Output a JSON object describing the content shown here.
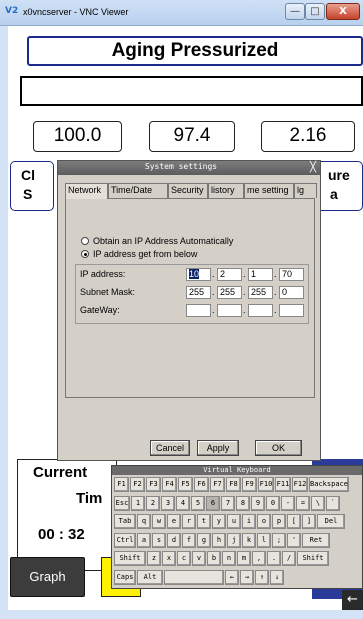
{
  "window": {
    "app_icon": "V2",
    "title": "x0vncserver - VNC Viewer",
    "min_glyph": "—",
    "max_glyph": "□",
    "close_glyph": "X"
  },
  "app": {
    "title": "Aging Pressurized",
    "readouts": [
      "100.0",
      "97.4",
      "2.16"
    ],
    "label_left": [
      "Cl",
      "S"
    ],
    "label_right": [
      "ure",
      "a"
    ],
    "current": {
      "line1": "Current",
      "line2": "Tim",
      "time": "00 : 32"
    },
    "graph_button": "Graph",
    "back_glyph": "←"
  },
  "dialog": {
    "title": "System settings",
    "close_glyph": "╳",
    "tabs": [
      "Network",
      "Time/Date",
      "Security",
      "listory",
      "me setting",
      "lg"
    ],
    "radio_auto": "Obtain an IP Address Automatically",
    "radio_manual": "IP address get from below",
    "ip": {
      "label": "IP address:",
      "octets": [
        "10",
        "2",
        "1",
        "70"
      ]
    },
    "mask": {
      "label": "Subnet Mask:",
      "octets": [
        "255",
        "255",
        "255",
        "0"
      ]
    },
    "gateway": {
      "label": "GateWay:",
      "octets": [
        "",
        "",
        "",
        ""
      ]
    },
    "buttons": {
      "cancel": "Cancel",
      "apply": "Apply",
      "ok": "OK"
    }
  },
  "keyboard": {
    "title": "Virtual Keyboard",
    "rows": [
      [
        "F1",
        "F2",
        "F3",
        "F4",
        "F5",
        "F6",
        "F7",
        "F8",
        "F9",
        "F10",
        "F11",
        "F12",
        "Backspace"
      ],
      [
        "Esc",
        "1",
        "2",
        "3",
        "4",
        "5",
        "6",
        "7",
        "8",
        "9",
        "0",
        "-",
        "=",
        "\\",
        "`"
      ],
      [
        "Tab",
        "q",
        "w",
        "e",
        "r",
        "t",
        "y",
        "u",
        "i",
        "o",
        "p",
        "[",
        "]",
        "Del"
      ],
      [
        "Ctrl",
        "a",
        "s",
        "d",
        "f",
        "g",
        "h",
        "j",
        "k",
        "l",
        ";",
        "'",
        "Ret"
      ],
      [
        "Shift",
        "z",
        "x",
        "c",
        "v",
        "b",
        "n",
        "m",
        ",",
        ".",
        "/",
        "Shift"
      ],
      [
        "Caps",
        "Alt",
        "",
        "←",
        "→",
        "↑",
        "↓"
      ]
    ]
  }
}
